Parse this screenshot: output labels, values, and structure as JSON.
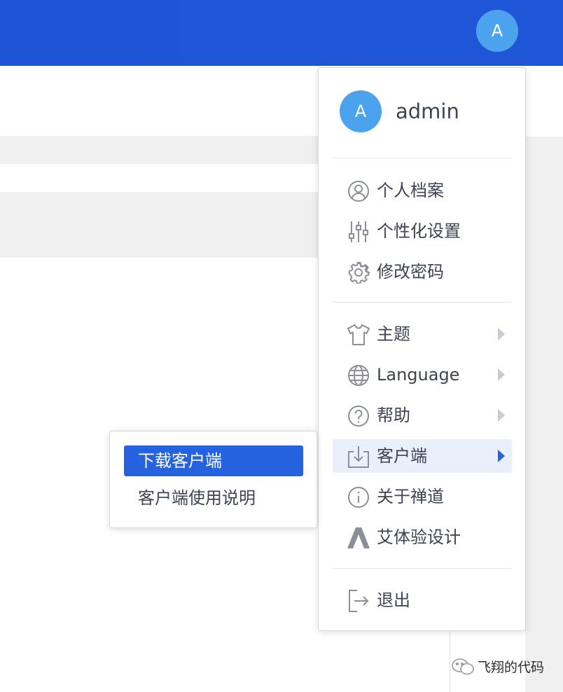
{
  "header": {
    "avatar_letter": "A",
    "brand_color": "#1f56d8"
  },
  "user_menu": {
    "avatar_letter": "A",
    "username": "admin",
    "groups": [
      [
        {
          "label": "个人档案",
          "icon": "user-circle-icon"
        },
        {
          "label": "个性化设置",
          "icon": "sliders-icon"
        },
        {
          "label": "修改密码",
          "icon": "gear-icon"
        }
      ],
      [
        {
          "label": "主题",
          "icon": "tshirt-icon",
          "has_submenu": true
        },
        {
          "label": "Language",
          "icon": "globe-icon",
          "has_submenu": true
        },
        {
          "label": "帮助",
          "icon": "help-circle-icon",
          "has_submenu": true
        },
        {
          "label": "客户端",
          "icon": "download-icon",
          "has_submenu": true,
          "active": true
        },
        {
          "label": "关于禅道",
          "icon": "info-circle-icon"
        },
        {
          "label": "艾体验设计",
          "icon": "brand-a-icon"
        }
      ],
      [
        {
          "label": "退出",
          "icon": "logout-icon"
        }
      ]
    ]
  },
  "client_submenu": {
    "items": [
      {
        "label": "下载客户端",
        "selected": true
      },
      {
        "label": "客户端使用说明",
        "selected": false
      }
    ],
    "selected_color": "#2462e0"
  },
  "watermark": {
    "text": "飞翔的代码"
  }
}
